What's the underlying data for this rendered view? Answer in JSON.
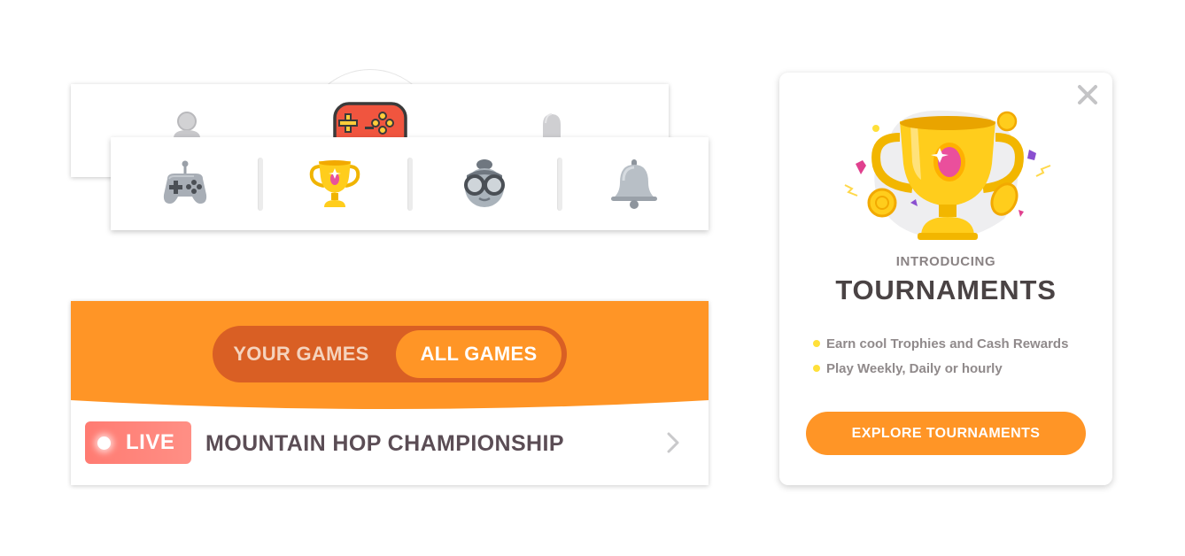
{
  "nav_back": {
    "icons": [
      "person-icon",
      "gamepad-icon",
      "bell-icon"
    ]
  },
  "nav_front": {
    "items": [
      {
        "icon": "gamepad-icon"
      },
      {
        "icon": "trophy-icon"
      },
      {
        "icon": "avatar-glasses-icon"
      },
      {
        "icon": "bell-icon"
      }
    ]
  },
  "games_panel": {
    "tabs": [
      {
        "label": "YOUR GAMES",
        "active": false
      },
      {
        "label": "ALL GAMES",
        "active": true
      }
    ],
    "tournament": {
      "badge": "LIVE",
      "name": "MOUNTAIN HOP CHAMPIONSHIP",
      "chevron_icon": "chevron-right-icon"
    }
  },
  "promo": {
    "close_icon": "close-icon",
    "art_icon": "trophy-icon",
    "intro": "INTRODUCING",
    "title": "TOURNAMENTS",
    "bullets": [
      "Earn cool Trophies and Cash Rewards",
      "Play Weekly, Daily or hourly"
    ],
    "cta_label": "EXPLORE TOURNAMENTS"
  },
  "colors": {
    "orange": "#ff9526",
    "dark_orange": "#d95f24",
    "live_red": "#ff7b72",
    "text_dark": "#4a4344",
    "gold": "#ffc93c"
  }
}
